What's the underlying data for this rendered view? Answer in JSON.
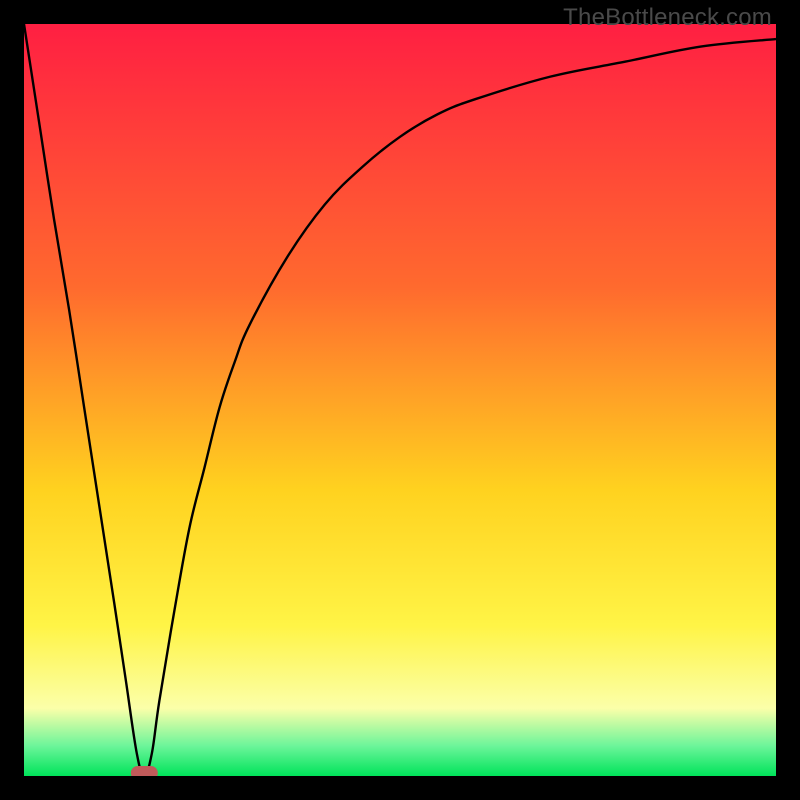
{
  "watermark": "TheBottleneck.com",
  "colors": {
    "top": "#ff1f42",
    "mid1": "#ff6a2e",
    "mid2": "#ffd21f",
    "mid3": "#fff446",
    "pale": "#fbffa9",
    "green_light": "#6cf59a",
    "green": "#00e35a",
    "frame": "#000000",
    "curve": "#000000",
    "marker": "#c05a5a"
  },
  "chart_data": {
    "type": "line",
    "title": "",
    "xlabel": "",
    "ylabel": "",
    "xlim": [
      0,
      100
    ],
    "ylim": [
      0,
      100
    ],
    "x": [
      0,
      2,
      4,
      6,
      8,
      10,
      12,
      13.5,
      15,
      16,
      17,
      18,
      20,
      22,
      24,
      26,
      28,
      30,
      35,
      40,
      45,
      50,
      55,
      60,
      70,
      80,
      90,
      100
    ],
    "y": [
      100,
      87,
      74,
      62,
      49,
      36,
      23,
      13,
      3,
      0,
      3,
      10,
      22,
      33,
      41,
      49,
      55,
      60,
      69,
      76,
      81,
      85,
      88,
      90,
      93,
      95,
      97,
      98
    ],
    "annotations": [
      {
        "kind": "marker",
        "x": 16,
        "y": 0,
        "shape": "pill"
      }
    ],
    "series": [
      {
        "name": "bottleneck-curve",
        "x_ref": "x",
        "y_ref": "y"
      }
    ]
  }
}
